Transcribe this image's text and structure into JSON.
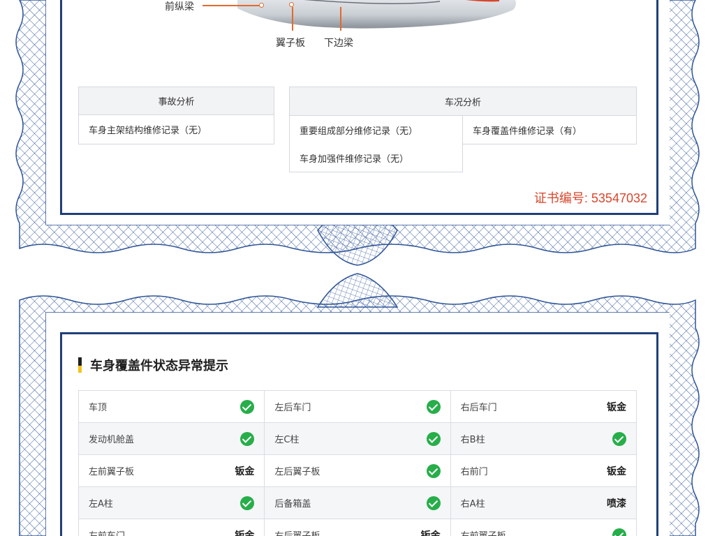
{
  "car_callouts": {
    "front_rail": "前纵梁",
    "fender": "翼子板",
    "rocker": "下边梁"
  },
  "accident_analysis": {
    "header": "事故分析",
    "items": [
      "车身主架结构维修记录（无）"
    ]
  },
  "condition_analysis": {
    "header": "车况分析",
    "items": [
      "重要组成部分维修记录（无）",
      "车身覆盖件维修记录（有）",
      "车身加强件维修记录（无）"
    ]
  },
  "certificate": {
    "text": "证书编号: 53547032"
  },
  "panel_section": {
    "title": "车身覆盖件状态异常提示",
    "rows": [
      [
        {
          "name": "车顶",
          "status": "ok"
        },
        {
          "name": "左后车门",
          "status": "ok"
        },
        {
          "name": "右后车门",
          "status": "钣金"
        }
      ],
      [
        {
          "name": "发动机舱盖",
          "status": "ok"
        },
        {
          "name": "左C柱",
          "status": "ok"
        },
        {
          "name": "右B柱",
          "status": "ok"
        }
      ],
      [
        {
          "name": "左前翼子板",
          "status": "钣金"
        },
        {
          "name": "左后翼子板",
          "status": "ok"
        },
        {
          "name": "右前门",
          "status": "钣金"
        }
      ],
      [
        {
          "name": "左A柱",
          "status": "ok"
        },
        {
          "name": "后备箱盖",
          "status": "ok"
        },
        {
          "name": "右A柱",
          "status": "喷漆"
        }
      ],
      [
        {
          "name": "左前车门",
          "status": "钣金"
        },
        {
          "name": "右后翼子板",
          "status": "钣金"
        },
        {
          "name": "右前翼子板",
          "status": "ok"
        }
      ]
    ]
  },
  "colors": {
    "frame_blue": "#1f3f7a",
    "guilloche_blue": "#2f5597",
    "ok_green": "#27ae4a",
    "cert_red": "#d8462b",
    "callout_orange": "#e06a2c"
  }
}
